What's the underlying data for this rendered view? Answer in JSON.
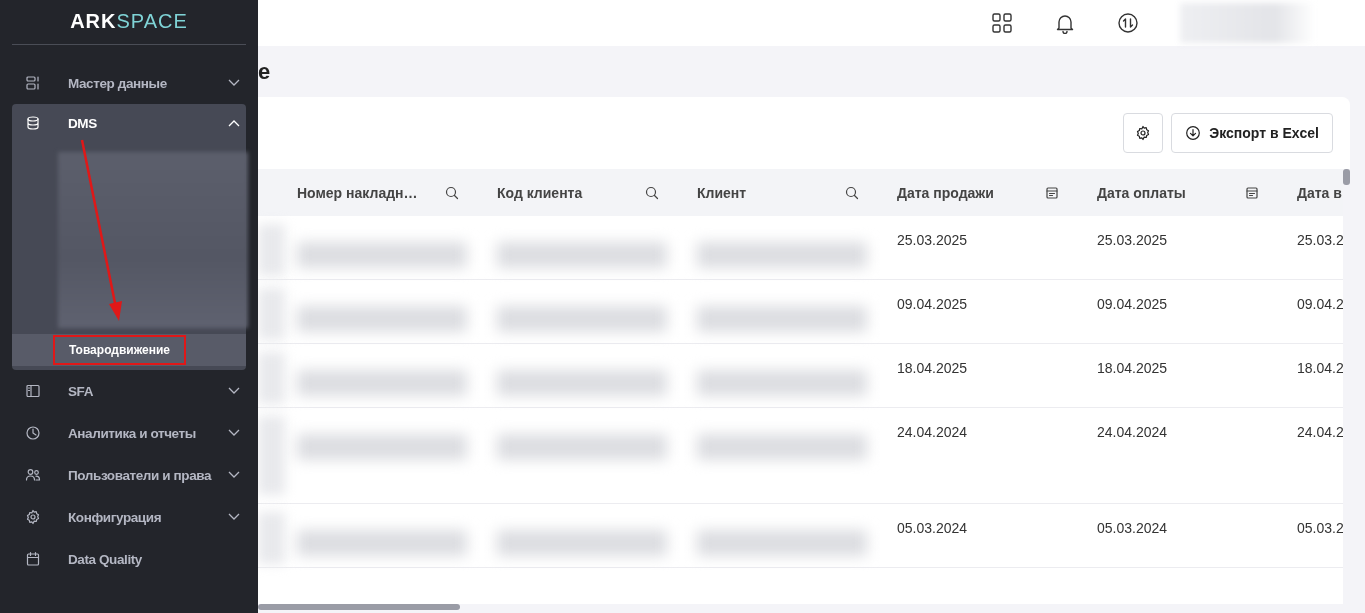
{
  "sidebar": {
    "logo": {
      "part_1": "ARK",
      "part_2": "SPACE"
    },
    "items": [
      {
        "label": "Мастер данные",
        "kind": "group",
        "expanded": false
      },
      {
        "label": "DMS",
        "kind": "group",
        "expanded": true,
        "children": [
          {
            "label": "Товародвижение",
            "selected": true,
            "highlighted": true
          }
        ]
      },
      {
        "label": "SFA",
        "kind": "group",
        "expanded": false
      },
      {
        "label": "Аналитика и отчеты",
        "kind": "group",
        "expanded": false
      },
      {
        "label": "Пользователи и права",
        "kind": "group",
        "expanded": false
      },
      {
        "label": "Конфигурация",
        "kind": "group",
        "expanded": false
      },
      {
        "label": "Data Quality",
        "kind": "link",
        "expanded": false
      }
    ],
    "annotations": [
      {
        "kind": "arrow"
      }
    ]
  },
  "page_title": "е",
  "toolbar": {
    "export_button": "Экспорт в Excel"
  },
  "table": {
    "columns": [
      {
        "label": "Номер накладн…",
        "kind": "search"
      },
      {
        "label": "Код клиента",
        "kind": "search"
      },
      {
        "label": "Клиент",
        "kind": "search"
      },
      {
        "label": "Дата продажи",
        "kind": "date"
      },
      {
        "label": "Дата оплаты",
        "kind": "date"
      },
      {
        "label": "Дата в",
        "kind": "plain"
      }
    ],
    "rows": [
      {
        "kind": "normal",
        "cells": [
          {
            "kind": "blurred"
          },
          {
            "kind": "blurred"
          },
          {
            "kind": "blurred"
          },
          {
            "kind": "text",
            "text": "25.03.2025"
          },
          {
            "kind": "text",
            "text": "25.03.2025"
          },
          {
            "kind": "text",
            "text": "25.03.2"
          }
        ]
      },
      {
        "kind": "normal",
        "cells": [
          {
            "kind": "blurred"
          },
          {
            "kind": "blurred"
          },
          {
            "kind": "blurred"
          },
          {
            "kind": "text",
            "text": "09.04.2025"
          },
          {
            "kind": "text",
            "text": "09.04.2025"
          },
          {
            "kind": "text",
            "text": "09.04.2"
          }
        ]
      },
      {
        "kind": "normal",
        "cells": [
          {
            "kind": "blurred"
          },
          {
            "kind": "blurred"
          },
          {
            "kind": "blurred"
          },
          {
            "kind": "text",
            "text": "18.04.2025"
          },
          {
            "kind": "text",
            "text": "18.04.2025"
          },
          {
            "kind": "text",
            "text": "18.04.2"
          }
        ]
      },
      {
        "kind": "tall",
        "cells": [
          {
            "kind": "blurred"
          },
          {
            "kind": "blurred"
          },
          {
            "kind": "blurred"
          },
          {
            "kind": "text",
            "text": "24.04.2024"
          },
          {
            "kind": "text",
            "text": "24.04.2024"
          },
          {
            "kind": "text",
            "text": "24.04.2"
          }
        ]
      },
      {
        "kind": "normal",
        "cells": [
          {
            "kind": "blurred"
          },
          {
            "kind": "blurred"
          },
          {
            "kind": "blurred"
          },
          {
            "kind": "text",
            "text": "05.03.2024"
          },
          {
            "kind": "text",
            "text": "05.03.2024"
          },
          {
            "kind": "text",
            "text": "05.03.2"
          }
        ]
      }
    ]
  }
}
